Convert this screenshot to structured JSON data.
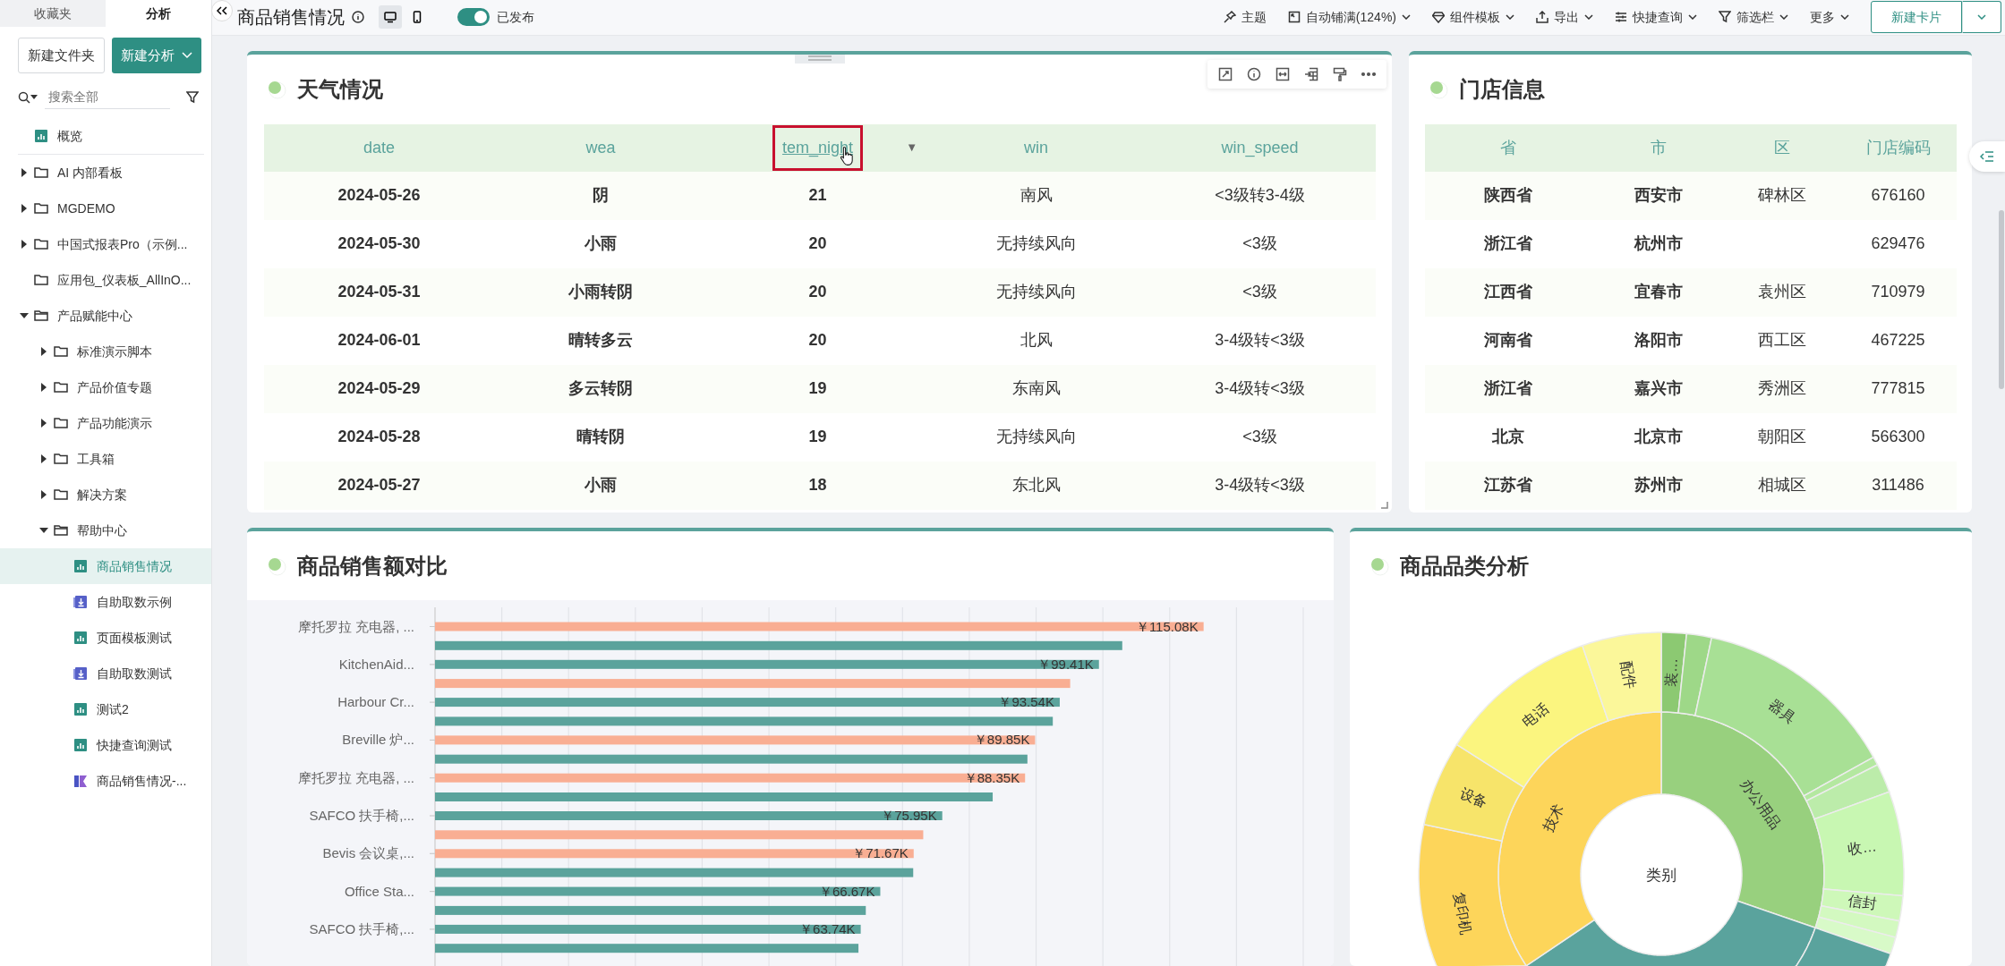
{
  "sidebar": {
    "tabs": [
      {
        "label": "收藏夹",
        "selected": false
      },
      {
        "label": "分析",
        "selected": true
      }
    ],
    "new_folder_button": "新建文件夹",
    "new_analysis_button": "新建分析",
    "search": {
      "placeholder": "搜索全部"
    },
    "tree": [
      {
        "label": "概览",
        "kind": "dashboard",
        "selected": false
      },
      {
        "label": "AI 内部看板",
        "kind": "folder",
        "expanded": false,
        "selected": false
      },
      {
        "label": "MGDEMO",
        "kind": "folder",
        "expanded": false,
        "selected": false
      },
      {
        "label": "中国式报表Pro（示例...",
        "kind": "folder",
        "expanded": false,
        "selected": false
      },
      {
        "label": "应用包_仪表板_AllInO...",
        "kind": "folder",
        "selected": false
      },
      {
        "label": "产品赋能中心",
        "kind": "folder",
        "expanded": true,
        "selected": false,
        "children": [
          {
            "label": "标准演示脚本",
            "kind": "folder",
            "expanded": false,
            "selected": false
          },
          {
            "label": "产品价值专题",
            "kind": "folder",
            "expanded": false,
            "selected": false
          },
          {
            "label": "产品功能演示",
            "kind": "folder",
            "expanded": false,
            "selected": false
          },
          {
            "label": "工具箱",
            "kind": "folder",
            "expanded": false,
            "selected": false
          },
          {
            "label": "解决方案",
            "kind": "folder",
            "expanded": false,
            "selected": false
          },
          {
            "label": "帮助中心",
            "kind": "folder",
            "expanded": true,
            "selected": false,
            "children": [
              {
                "label": "商品销售情况",
                "kind": "dashboard",
                "selected": true
              },
              {
                "label": "自助取数示例",
                "kind": "extract",
                "selected": false
              },
              {
                "label": "页面模板测试",
                "kind": "dashboard",
                "selected": false
              },
              {
                "label": "自助取数测试",
                "kind": "extract",
                "selected": false
              },
              {
                "label": "测试2",
                "kind": "dashboard",
                "selected": false
              },
              {
                "label": "快捷查询测试",
                "kind": "dashboard",
                "selected": false
              },
              {
                "label": "商品销售情况-...",
                "kind": "report",
                "selected": false
              }
            ]
          }
        ]
      }
    ]
  },
  "toolbar": {
    "title": "商品销售情况",
    "views": [
      {
        "kind": "desktop",
        "selected": true
      },
      {
        "kind": "mobile",
        "selected": false
      }
    ],
    "publish": {
      "label": "已发布",
      "on": true
    },
    "actions": [
      {
        "kind": "theme",
        "label": "主题",
        "dropdown": false
      },
      {
        "kind": "autofit",
        "label": "自动铺满(124%)",
        "dropdown": true
      },
      {
        "kind": "template",
        "label": "组件模板",
        "dropdown": true
      },
      {
        "kind": "export",
        "label": "导出",
        "dropdown": true
      },
      {
        "kind": "query",
        "label": "快捷查询",
        "dropdown": true
      },
      {
        "kind": "filter",
        "label": "筛选栏",
        "dropdown": true
      },
      {
        "kind": "more",
        "label": "更多",
        "dropdown": true
      }
    ],
    "new_card_button": "新建卡片"
  },
  "weather_card": {
    "title": "天气情况",
    "columns": [
      {
        "label": "date",
        "bold": true,
        "selected": false
      },
      {
        "label": "wea",
        "bold": true,
        "selected": false
      },
      {
        "label": "tem_night",
        "bold": true,
        "selected": true,
        "arrow": "▼"
      },
      {
        "label": "win",
        "bold": false,
        "selected": false
      },
      {
        "label": "win_speed",
        "bold": false,
        "selected": false
      }
    ],
    "rows": [
      [
        "2024-05-26",
        "阴",
        "21",
        "南风",
        "<3级转3-4级"
      ],
      [
        "2024-05-30",
        "小雨",
        "20",
        "无持续风向",
        "<3级"
      ],
      [
        "2024-05-31",
        "小雨转阴",
        "20",
        "无持续风向",
        "<3级"
      ],
      [
        "2024-06-01",
        "晴转多云",
        "20",
        "北风",
        "3-4级转<3级"
      ],
      [
        "2024-05-29",
        "多云转阴",
        "19",
        "东南风",
        "3-4级转<3级"
      ],
      [
        "2024-05-28",
        "晴转阴",
        "19",
        "无持续风向",
        "<3级"
      ],
      [
        "2024-05-27",
        "小雨",
        "18",
        "东北风",
        "3-4级转<3级"
      ]
    ]
  },
  "store_card": {
    "title": "门店信息",
    "columns": [
      {
        "label": "省",
        "bold": true
      },
      {
        "label": "市",
        "bold": true
      },
      {
        "label": "区",
        "bold": false
      },
      {
        "label": "门店编码",
        "bold": false
      }
    ],
    "rows": [
      [
        "陕西省",
        "西安市",
        "碑林区",
        "676160"
      ],
      [
        "浙江省",
        "杭州市",
        null,
        "629476"
      ],
      [
        "江西省",
        "宜春市",
        "袁州区",
        "710979"
      ],
      [
        "河南省",
        "洛阳市",
        "西工区",
        "467225"
      ],
      [
        "浙江省",
        "嘉兴市",
        "秀洲区",
        "777815"
      ],
      [
        "北京",
        "北京市",
        "朝阳区",
        "566300"
      ],
      [
        "江苏省",
        "苏州市",
        "相城区",
        "311486"
      ]
    ]
  },
  "sales_card": {
    "title": "商品销售额对比",
    "chart_data": {
      "type": "bar",
      "orientation": "horizontal",
      "xlim": [
        0,
        130
      ],
      "categories": [
        "摩托罗拉 充电器, ...",
        "KitchenAid...",
        "Harbour Cr...",
        "Breville 炉...",
        "摩托罗拉 充电器, ...",
        "SAFCO 扶手椅,...",
        "Bevis 会议桌,...",
        "Office Sta...",
        "SAFCO 扶手椅,..."
      ],
      "series": [
        {
          "values": [
            115.08,
            99.41,
            93.54,
            89.85,
            88.35,
            75.95,
            71.67,
            66.67,
            63.74
          ],
          "colors": [
            "#f9ae93",
            "#5ba39c",
            "#5ba39c",
            "#f9ae93",
            "#f9ae93",
            "#5ba39c",
            "#f9ae93",
            "#5ba39c",
            "#5ba39c"
          ],
          "value_labels": [
            "￥115.08K",
            "￥99.41K",
            "￥93.54K",
            "￥89.85K",
            "￥88.35K",
            "￥75.95K",
            "￥71.67K",
            "￥66.67K",
            "￥63.74K"
          ]
        },
        {
          "values": [
            102.9,
            95.1,
            92.5,
            88.7,
            83.5,
            73.1,
            71.6,
            64.5,
            63.4
          ],
          "colors": [
            "#5ba39c",
            "#f9ae93",
            "#5ba39c",
            "#5ba39c",
            "#5ba39c",
            "#f9ae93",
            "#5ba39c",
            "#5ba39c",
            "#5ba39c"
          ]
        }
      ]
    }
  },
  "category_card": {
    "title": "商品品类分析",
    "center_label": "类别",
    "inner_ring": [
      {
        "label": "办公用品",
        "color": "#98d07e"
      },
      {
        "color": "#5aa39d"
      },
      {
        "label": "技术",
        "color": "#fdd55a"
      }
    ],
    "outer_ring": [
      {
        "label": "装…",
        "color": "#8cc972"
      },
      {
        "color": "#9ed888"
      },
      {
        "label": "器具",
        "color": "#a8e095"
      },
      {
        "color": "#b4e8a0"
      },
      {
        "color": "#bcecaa"
      },
      {
        "label": "收…",
        "color": "#c8f7b2"
      },
      {
        "label": "信封",
        "color": "#cef8b9"
      },
      {
        "color": "#d3f9c0"
      },
      {
        "color": "#d8fac8"
      },
      {
        "color": "#5aa39d"
      },
      {
        "label": "复印机",
        "color": "#fdd55a"
      },
      {
        "label": "设备",
        "color": "#f7e46a"
      },
      {
        "label": "电话",
        "color": "#fbf57f"
      },
      {
        "label": "配件",
        "color": "#fbf79a"
      }
    ]
  }
}
